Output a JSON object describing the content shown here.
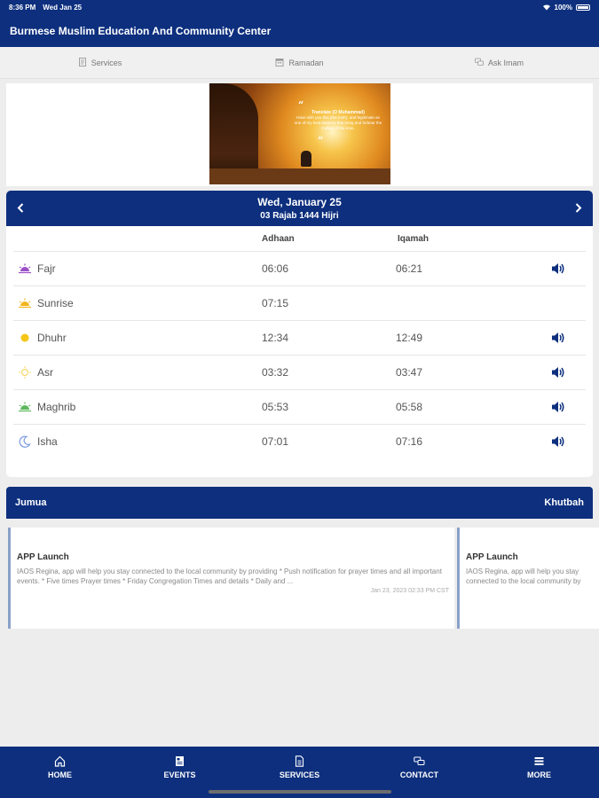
{
  "status_bar": {
    "time": "8:36 PM",
    "date": "Wed Jan 25",
    "battery": "100%"
  },
  "header": {
    "title": "Burmese Muslim Education And Community Center"
  },
  "top_tabs": [
    {
      "label": "Services",
      "icon": "document-icon"
    },
    {
      "label": "Ramadan",
      "icon": "calendar-icon"
    },
    {
      "label": "Ask Imam",
      "icon": "chat-icon"
    }
  ],
  "banner": {
    "quote_title": "Translate (O Muhammad)",
    "quote_text": "Have with you this (the truth), and legitimate as one of my best lanterns that bring and forbear the Calling of the eras."
  },
  "prayer_times": {
    "date": "Wed, January 25",
    "hijri_date": "03 Rajab 1444 Hijri",
    "col_adhaan": "Adhaan",
    "col_iqamah": "Iqamah",
    "rows": [
      {
        "name": "Fajr",
        "adhaan": "06:06",
        "iqamah": "06:21",
        "icon_color": "#9b4fc8"
      },
      {
        "name": "Sunrise",
        "adhaan": "07:15",
        "iqamah": "",
        "icon_color": "#f2b51f"
      },
      {
        "name": "Dhuhr",
        "adhaan": "12:34",
        "iqamah": "12:49",
        "icon_color": "#f5c518"
      },
      {
        "name": "Asr",
        "adhaan": "03:32",
        "iqamah": "03:47",
        "icon_color": "#f5d86a"
      },
      {
        "name": "Maghrib",
        "adhaan": "05:53",
        "iqamah": "05:58",
        "icon_color": "#5cb85c"
      },
      {
        "name": "Isha",
        "adhaan": "07:01",
        "iqamah": "07:16",
        "icon_color": "#7a9ae0"
      }
    ]
  },
  "jumua": {
    "left_label": "Jumua",
    "right_label": "Khutbah"
  },
  "news": [
    {
      "title": "APP Launch",
      "body": "IAOS Regina, app will help you stay connected to the local community by providing * Push notification for prayer times and all important events. * Five times Prayer times * Friday Congregation Times and details * Daily and ...",
      "date": "Jan 23, 2023 02:33 PM CST"
    },
    {
      "title": "APP Launch",
      "body": "IAOS Regina, app will help you stay connected to the local community by providing * Push notification for prayer times and all important events. * Five times Prayer times * Friday Congregation Times and details * Daily and ...",
      "date": ""
    }
  ],
  "bottom_nav": [
    {
      "label": "HOME",
      "icon": "home-icon"
    },
    {
      "label": "EVENTS",
      "icon": "events-icon"
    },
    {
      "label": "SERVICES",
      "icon": "services-icon"
    },
    {
      "label": "CONTACT",
      "icon": "contact-icon"
    },
    {
      "label": "MORE",
      "icon": "menu-icon"
    }
  ],
  "colors": {
    "primary": "#0d2f7e",
    "background": "#ededed"
  }
}
